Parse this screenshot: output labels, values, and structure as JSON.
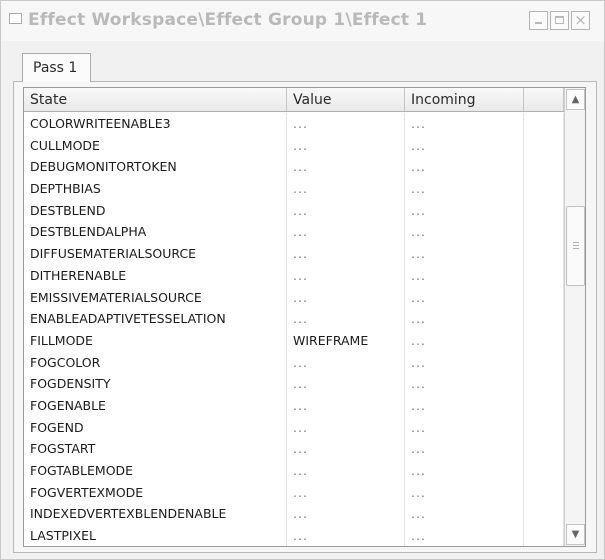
{
  "window": {
    "title": "Effect Workspace\\Effect Group 1\\Effect 1",
    "buttons": {
      "minimize": "_",
      "maximize": "□",
      "close": "×"
    }
  },
  "tabs": [
    {
      "label": "Pass 1",
      "selected": true
    }
  ],
  "grid": {
    "columns": [
      "State",
      "Value",
      "Incoming",
      ""
    ],
    "rows": [
      {
        "state": "COLORWRITEENABLE3",
        "value": "...",
        "incoming": "..."
      },
      {
        "state": "CULLMODE",
        "value": "...",
        "incoming": "..."
      },
      {
        "state": "DEBUGMONITORTOKEN",
        "value": "...",
        "incoming": "..."
      },
      {
        "state": "DEPTHBIAS",
        "value": "...",
        "incoming": "..."
      },
      {
        "state": "DESTBLEND",
        "value": "...",
        "incoming": "..."
      },
      {
        "state": "DESTBLENDALPHA",
        "value": "...",
        "incoming": "..."
      },
      {
        "state": "DIFFUSEMATERIALSOURCE",
        "value": "...",
        "incoming": "..."
      },
      {
        "state": "DITHERENABLE",
        "value": "...",
        "incoming": "..."
      },
      {
        "state": "EMISSIVEMATERIALSOURCE",
        "value": "...",
        "incoming": "..."
      },
      {
        "state": "ENABLEADAPTIVETESSELATION",
        "value": "...",
        "incoming": "..."
      },
      {
        "state": "FILLMODE",
        "value": "WIREFRAME",
        "incoming": "..."
      },
      {
        "state": "FOGCOLOR",
        "value": "...",
        "incoming": "..."
      },
      {
        "state": "FOGDENSITY",
        "value": "...",
        "incoming": "..."
      },
      {
        "state": "FOGENABLE",
        "value": "...",
        "incoming": "..."
      },
      {
        "state": "FOGEND",
        "value": "...",
        "incoming": "..."
      },
      {
        "state": "FOGSTART",
        "value": "...",
        "incoming": "..."
      },
      {
        "state": "FOGTABLEMODE",
        "value": "...",
        "incoming": "..."
      },
      {
        "state": "FOGVERTEXMODE",
        "value": "...",
        "incoming": "..."
      },
      {
        "state": "INDEXEDVERTEXBLENDENABLE",
        "value": "...",
        "incoming": "..."
      },
      {
        "state": "LASTPIXEL",
        "value": "...",
        "incoming": "..."
      }
    ]
  },
  "scrollbar": {
    "up_glyph": "▲",
    "down_glyph": "▼",
    "position": 0.3
  }
}
